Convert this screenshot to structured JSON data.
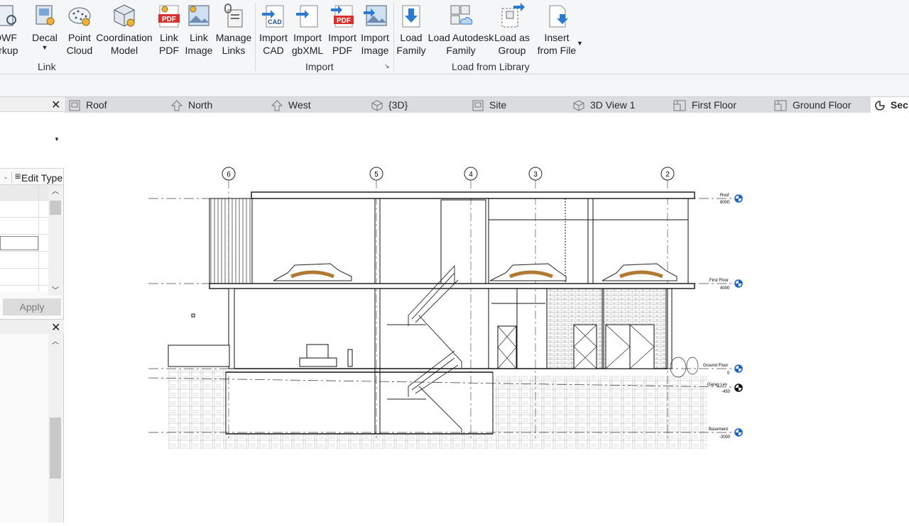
{
  "ribbon": {
    "buttons": [
      {
        "id": "dwf",
        "label": "DWF\narkup"
      },
      {
        "id": "decal",
        "label": "Decal"
      },
      {
        "id": "pointcloud",
        "label": "Point\nCloud"
      },
      {
        "id": "coord",
        "label": "Coordination\nModel"
      },
      {
        "id": "linkpdf",
        "label": "Link\nPDF"
      },
      {
        "id": "linkimg",
        "label": "Link\nImage"
      },
      {
        "id": "managelinks",
        "label": "Manage\nLinks"
      },
      {
        "id": "importcad",
        "label": "Import\nCAD"
      },
      {
        "id": "importgbxml",
        "label": "Import\ngbXML"
      },
      {
        "id": "importpdf",
        "label": "Import\nPDF"
      },
      {
        "id": "importimage",
        "label": "Import\nImage"
      },
      {
        "id": "loadfamily",
        "label": "Load\nFamily"
      },
      {
        "id": "loadautodesk",
        "label": "Load Autodesk\nFamily"
      },
      {
        "id": "loadgroup",
        "label": "Load as\nGroup"
      },
      {
        "id": "insertfile",
        "label": "Insert\nfrom File"
      }
    ],
    "groups": {
      "link": "Link",
      "import": "Import",
      "library": "Load from Library"
    }
  },
  "properties": {
    "edit_type": "Edit Type",
    "apply": "Apply"
  },
  "tabs": [
    {
      "label": "Roof",
      "icon": "plan-view-icon"
    },
    {
      "label": "North",
      "icon": "elevation-icon"
    },
    {
      "label": "West",
      "icon": "elevation-icon"
    },
    {
      "label": "{3D}",
      "icon": "3d-view-icon"
    },
    {
      "label": "Site",
      "icon": "plan-view-icon"
    },
    {
      "label": "3D View 1",
      "icon": "3d-view-icon"
    },
    {
      "label": "First Floor",
      "icon": "floor-plan-icon"
    },
    {
      "label": "Ground Floor",
      "icon": "floor-plan-icon"
    },
    {
      "label": "Sec",
      "icon": "section-icon",
      "active": true
    }
  ],
  "drawing": {
    "grids": [
      "6",
      "5",
      "4",
      "3",
      "2"
    ],
    "levels": [
      {
        "name": "Roof",
        "elev": "8000"
      },
      {
        "name": "First Floor",
        "elev": "4000"
      },
      {
        "name": "Ground Floor",
        "elev": "0"
      },
      {
        "name": "Garag Lev",
        "elev": "-450"
      },
      {
        "name": "Basement",
        "elev": "-3000"
      }
    ]
  },
  "colors": {
    "ribbon_bg": "#f5f6f7",
    "tab_bar": "#dadcdf",
    "level_head": "#1a63c9"
  }
}
